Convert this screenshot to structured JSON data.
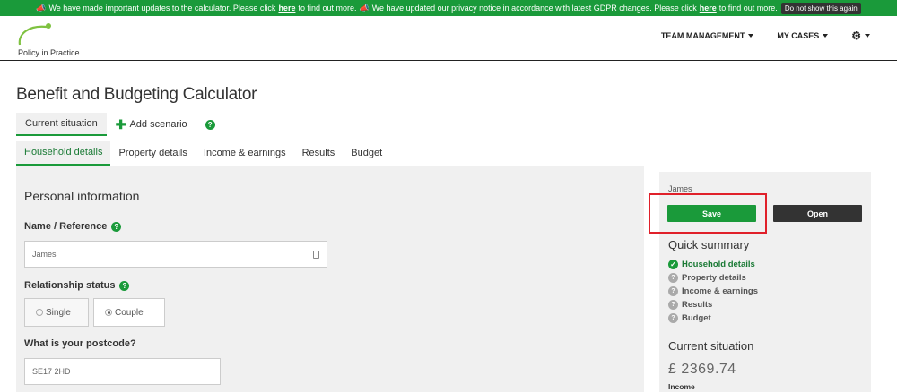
{
  "banner": {
    "text1": "We have made important updates to the calculator. Please click",
    "link1": "here",
    "text2": "to find out more.",
    "text3": "We have updated our privacy notice in accordance with latest GDPR changes. Please click",
    "link2": "here",
    "text4": "to find out more.",
    "dismiss": "Do not show this again"
  },
  "brand": {
    "logo_text": "Policy in Practice",
    "color": "#1a9a3a"
  },
  "nav": {
    "team": "TEAM MANAGEMENT",
    "cases": "MY CASES"
  },
  "title": "Benefit and Budgeting Calculator",
  "scenario_tabs": {
    "current": "Current situation",
    "add": "Add scenario"
  },
  "section_tabs": [
    "Household details",
    "Property details",
    "Income & earnings",
    "Results",
    "Budget"
  ],
  "form": {
    "section_title": "Personal information",
    "name_label": "Name / Reference",
    "name_value": "James",
    "relationship_label": "Relationship status",
    "options": [
      "Single",
      "Couple"
    ],
    "postcode_label": "What is your postcode?",
    "postcode_value": "SE17 2HD"
  },
  "sidebar": {
    "name": "James",
    "save": "Save",
    "open": "Open",
    "quick_summary": "Quick summary",
    "summary_items": [
      "Household details",
      "Property details",
      "Income & earnings",
      "Results",
      "Budget"
    ],
    "current_situation": "Current situation",
    "amount": "£ 2369.74",
    "income_label": "Income"
  }
}
